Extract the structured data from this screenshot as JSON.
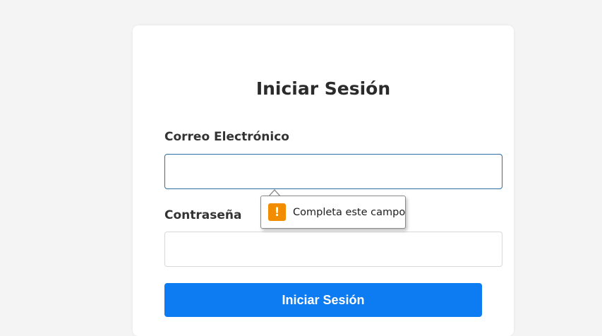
{
  "login": {
    "title": "Iniciar Sesión",
    "email_label": "Correo Electrónico",
    "email_value": "",
    "password_label": "Contraseña",
    "password_value": "",
    "submit_label": "Iniciar Sesión"
  },
  "validation": {
    "icon": "warning-icon",
    "icon_glyph": "!",
    "message": "Completa este campo"
  },
  "colors": {
    "background": "#f4f4f4",
    "card": "#ffffff",
    "primary_button": "#0d7bf2",
    "focus_border": "#2b6fa6",
    "warning": "#f28c00"
  }
}
